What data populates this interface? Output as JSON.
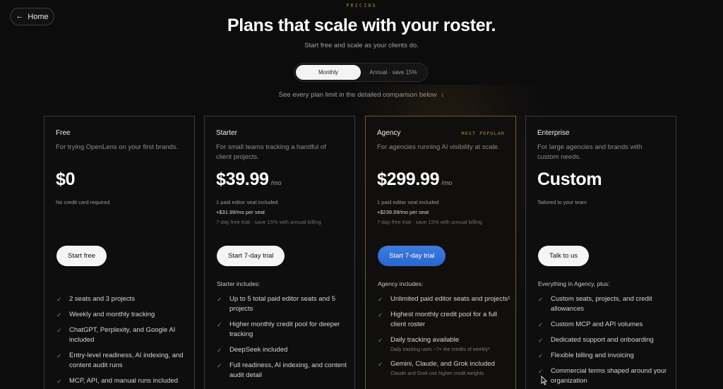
{
  "nav": {
    "home_label": "Home"
  },
  "header": {
    "eyebrow": "PRICING",
    "title": "Plans that scale with your roster.",
    "subtitle": "Start free and scale as your clients do."
  },
  "billing_toggle": {
    "monthly": "Monthly",
    "annual": "Annual · save 15%",
    "selected": "Monthly"
  },
  "compare_link": "See every plan limit in the detailed comparison below",
  "plans": [
    {
      "name": "Free",
      "description": "For trying OpenLens on your first brands.",
      "price": "$0",
      "period": "",
      "notes": [
        "No credit card required"
      ],
      "cta": "Start free",
      "includes_heading": "",
      "features": [
        {
          "text": "2 seats and 3 projects",
          "sub": ""
        },
        {
          "text": "Weekly and monthly tracking",
          "sub": ""
        },
        {
          "text": "ChatGPT, Perplexity, and Google AI included",
          "sub": ""
        },
        {
          "text": "Entry-level readiness, AI indexing, and content audit runs",
          "sub": ""
        },
        {
          "text": "MCP, API, and manual runs included",
          "sub": ""
        }
      ]
    },
    {
      "name": "Starter",
      "description": "For small teams tracking a handful of client projects.",
      "price": "$39.99",
      "period": "/mo",
      "notes": [
        "1 paid editor seat included",
        "+$31.99/mo per seat",
        "7-day free trial · save 15% with annual billing"
      ],
      "cta": "Start 7-day trial",
      "includes_heading": "Starter includes:",
      "features": [
        {
          "text": "Up to 5 total paid editor seats and 5 projects",
          "sub": ""
        },
        {
          "text": "Higher monthly credit pool for deeper tracking",
          "sub": ""
        },
        {
          "text": "DeepSeek included",
          "sub": ""
        },
        {
          "text": "Full readiness, AI indexing, and content audit detail",
          "sub": ""
        }
      ]
    },
    {
      "name": "Agency",
      "badge": "MOST POPULAR",
      "description": "For agencies running AI visibility at scale.",
      "price": "$299.99",
      "period": "/mo",
      "notes": [
        "1 paid editor seat included",
        "+$239.99/mo per seat",
        "7-day free trial · save 15% with annual billing"
      ],
      "cta": "Start 7-day trial",
      "includes_heading": "Agency includes:",
      "features": [
        {
          "text": "Unlimited paid editor seats and projects¹",
          "sub": ""
        },
        {
          "text": "Highest monthly credit pool for a full client roster",
          "sub": ""
        },
        {
          "text": "Daily tracking available",
          "sub": "Daily tracking uses ~7× the credits of weekly²"
        },
        {
          "text": "Gemini, Claude, and Grok included",
          "sub": "Claude and Grok use higher credit weights"
        }
      ]
    },
    {
      "name": "Enterprise",
      "description": "For large agencies and brands with custom needs.",
      "price": "Custom",
      "period": "",
      "notes": [
        "Tailored to your team"
      ],
      "cta": "Talk to us",
      "includes_heading": "Everything in Agency, plus:",
      "features": [
        {
          "text": "Custom seats, projects, and credit allowances",
          "sub": ""
        },
        {
          "text": "Custom MCP and API volumes",
          "sub": ""
        },
        {
          "text": "Dedicated support and onboarding",
          "sub": ""
        },
        {
          "text": "Flexible billing and invoicing",
          "sub": ""
        },
        {
          "text": "Commercial terms shaped around your organization",
          "sub": ""
        }
      ]
    }
  ],
  "colors": {
    "background": "#0c0c0d",
    "check": "#3fa36a",
    "accent_blue": "#2a66cf",
    "badge_gold": "#b88c3e"
  }
}
